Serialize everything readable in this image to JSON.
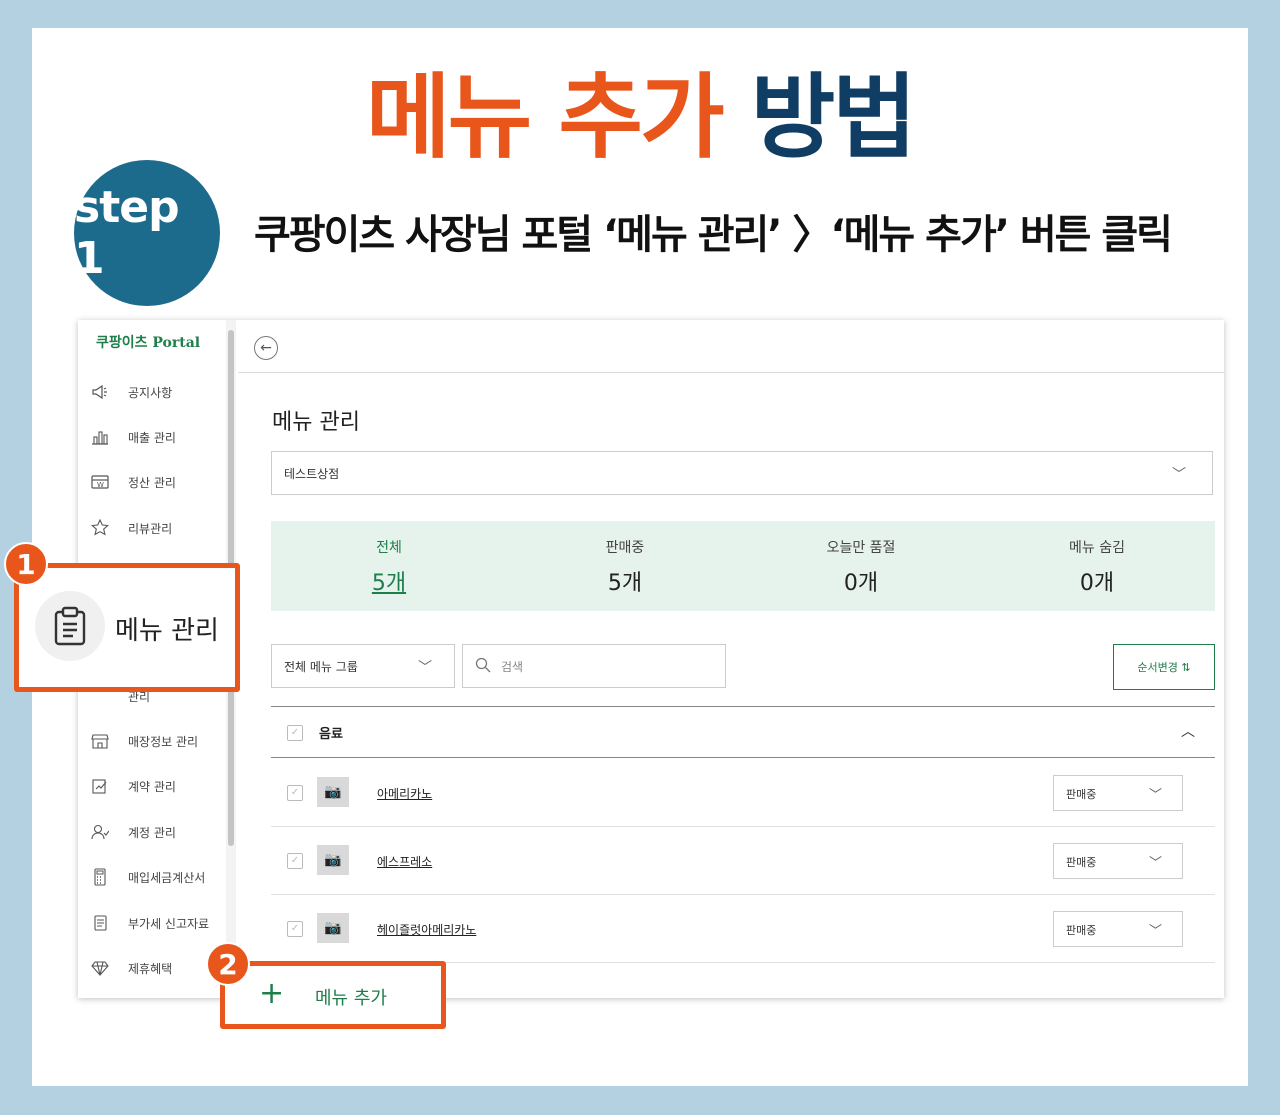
{
  "headline": {
    "part1": "메뉴 추가",
    "part2": "방법"
  },
  "step": {
    "label": "step 1",
    "instruction": "쿠팡이츠 사장님 포털 ‘메뉴 관리’ 〉‘메뉴 추가’ 버튼 클릭"
  },
  "sidebar": {
    "brand": "쿠팡이츠 Portal",
    "items": [
      {
        "label": "공지사항",
        "icon": "megaphone-icon"
      },
      {
        "label": "매출 관리",
        "icon": "bar-chart-icon"
      },
      {
        "label": "정산 관리",
        "icon": "settlement-icon"
      },
      {
        "label": "리뷰관리",
        "icon": "star-review-icon"
      },
      {
        "label": "매장정보 관리",
        "icon": "store-icon"
      },
      {
        "label": "계약 관리",
        "icon": "contract-icon"
      },
      {
        "label": "계정 관리",
        "icon": "account-icon"
      },
      {
        "label": "매입세금계산서",
        "icon": "calculator-icon"
      },
      {
        "label": "부가세 신고자료",
        "icon": "document-icon"
      },
      {
        "label": "제휴혜택",
        "icon": "diamond-icon"
      }
    ],
    "partial_label": "관리"
  },
  "highlight1": {
    "badge": "1",
    "label": "메뉴 관리"
  },
  "highlight2": {
    "badge": "2",
    "label": "메뉴 추가"
  },
  "main": {
    "title": "메뉴 관리",
    "store_select": "테스트상점",
    "stats": [
      {
        "label": "전체",
        "value": "5개"
      },
      {
        "label": "판매중",
        "value": "5개"
      },
      {
        "label": "오늘만 품절",
        "value": "0개"
      },
      {
        "label": "메뉴 숨김",
        "value": "0개"
      }
    ],
    "group_filter": "전체 메뉴 그룹",
    "search_placeholder": "검색",
    "order_button": "순서변경 ⇅",
    "group_name": "음료",
    "items": [
      {
        "name": "아메리카노",
        "status": "판매중"
      },
      {
        "name": "에스프레소",
        "status": "판매중"
      },
      {
        "name": "헤이즐럿아메리카노",
        "status": "판매중"
      }
    ]
  }
}
